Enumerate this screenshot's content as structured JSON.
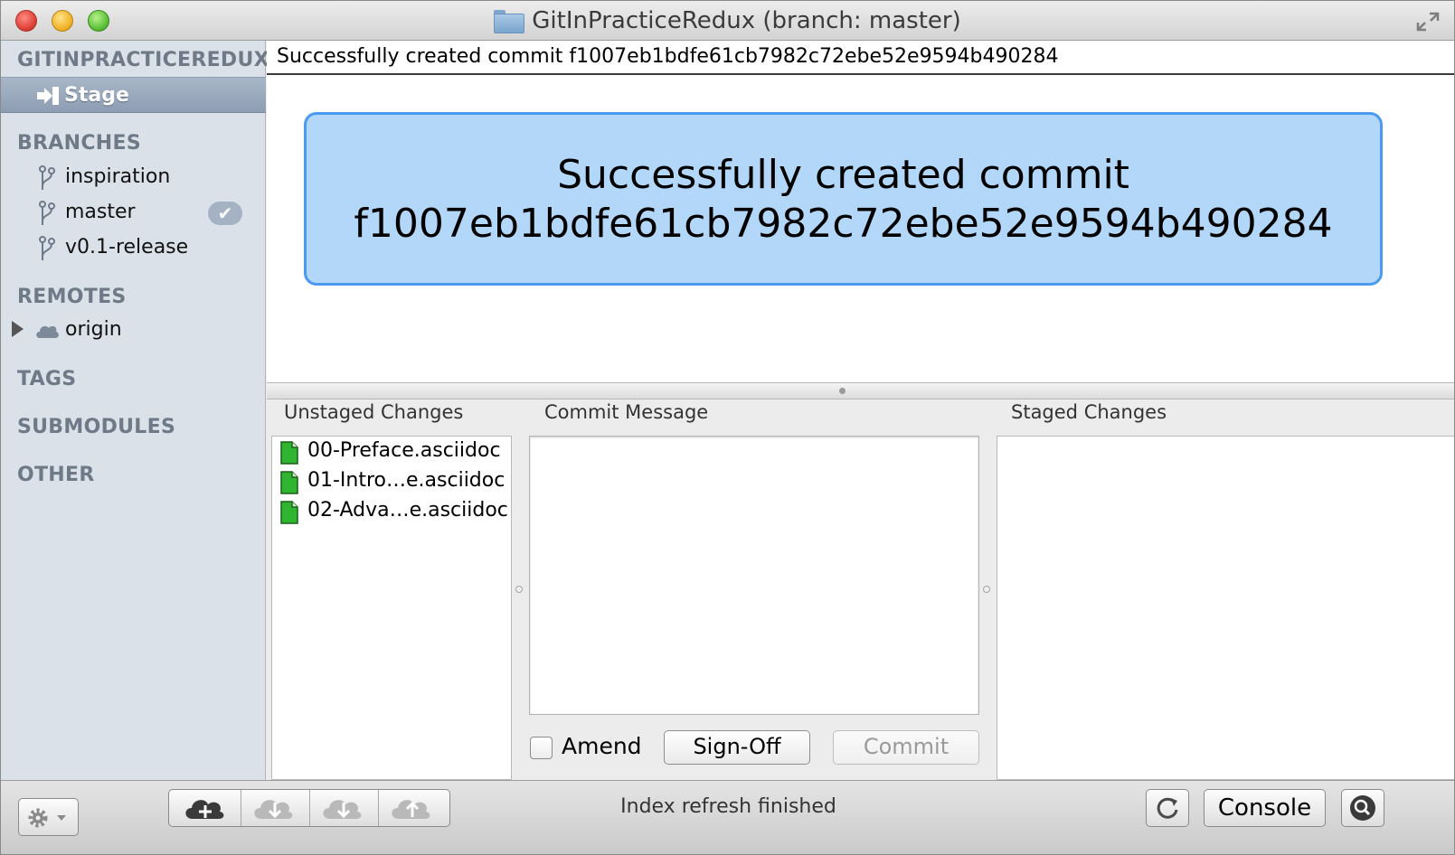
{
  "window": {
    "title": "GitInPracticeRedux (branch: master)"
  },
  "sidebar": {
    "repo_header": "GITINPRACTICEREDUX",
    "stage_label": "Stage",
    "branches_header": "BRANCHES",
    "branches": [
      {
        "label": "inspiration",
        "checked": false
      },
      {
        "label": "master",
        "checked": true,
        "check_glyph": "✔"
      },
      {
        "label": "v0.1-release",
        "checked": false
      }
    ],
    "remotes_header": "REMOTES",
    "remotes": [
      {
        "label": "origin",
        "expanded": false
      }
    ],
    "tags_header": "TAGS",
    "submodules_header": "SUBMODULES",
    "other_header": "OTHER"
  },
  "main": {
    "status_line": "Successfully created commit f1007eb1bdfe61cb7982c72ebe52e9594b490284",
    "notice_line1": "Successfully created commit",
    "notice_line2": "f1007eb1bdfe61cb7982c72ebe52e9594b490284"
  },
  "panes": {
    "unstaged_title": "Unstaged Changes",
    "commit_message_title": "Commit Message",
    "staged_title": "Staged Changes",
    "unstaged_files": [
      {
        "label": "00-Preface.asciidoc"
      },
      {
        "label": "01-Intro…e.asciidoc"
      },
      {
        "label": "02-Adva…e.asciidoc"
      }
    ],
    "commit_message_value": "",
    "amend_label": "Amend",
    "amend_checked": false,
    "signoff_label": "Sign-Off",
    "commit_label": "Commit"
  },
  "bottombar": {
    "status": "Index refresh finished",
    "console_label": "Console"
  },
  "colors": {
    "notice_bg": "#b3d7f8",
    "notice_border": "#4a9af0",
    "file_icon": "#2fb52f",
    "sidebar_bg": "#dbe1e8",
    "section_header": "#6e7a87"
  },
  "icons": {
    "traffic": [
      "close",
      "minimize",
      "zoom"
    ],
    "title": "folder-icon",
    "fullscreen": "fullscreen-icon",
    "stage": "stage-arrow-icon",
    "branch": "branch-icon",
    "remote": "cloud-icon",
    "file": "file-icon",
    "toolbar": [
      "gear-icon",
      "new-remote-icon",
      "fetch-icon",
      "pull-icon",
      "push-icon",
      "refresh-icon",
      "search-icon"
    ]
  }
}
